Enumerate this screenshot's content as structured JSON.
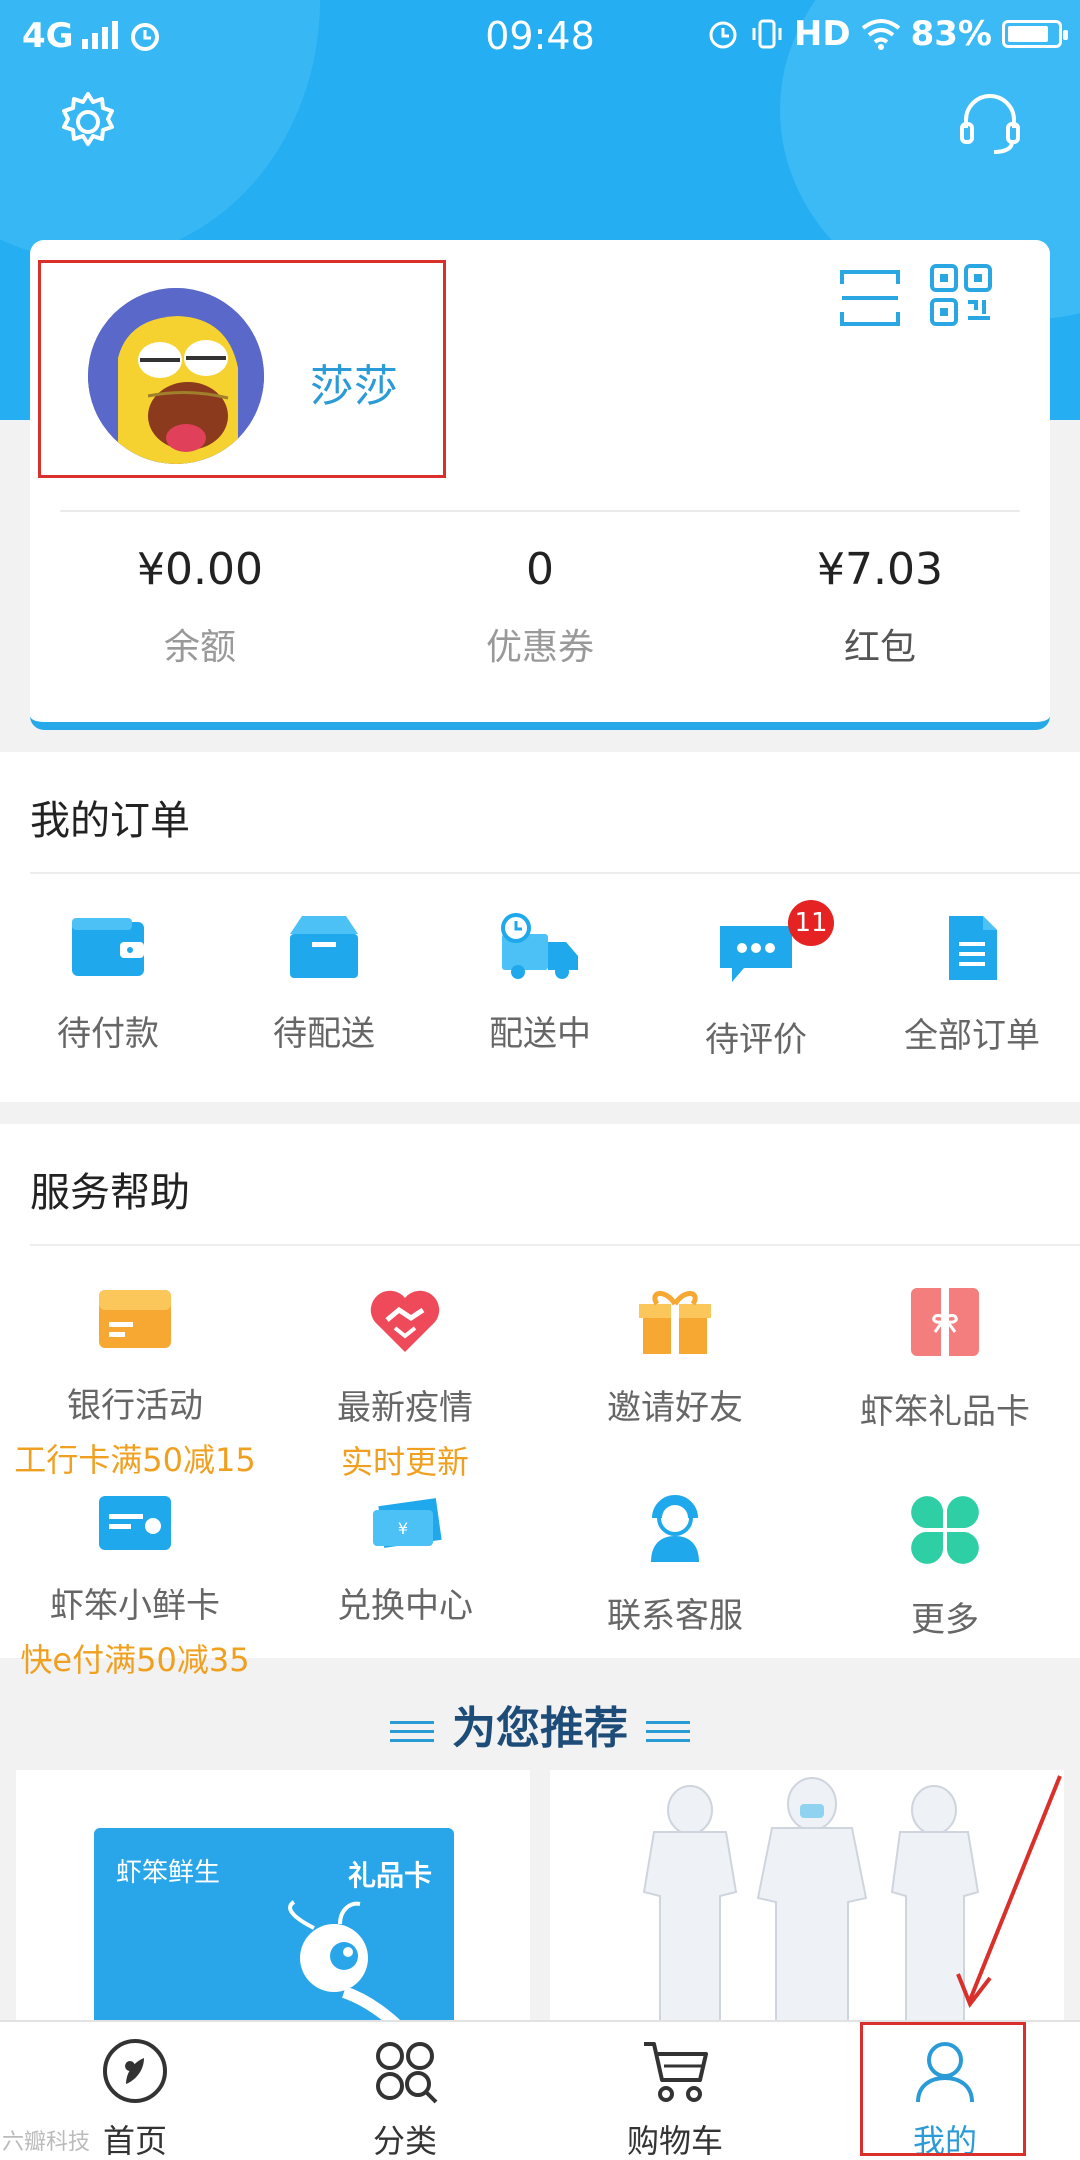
{
  "status_bar": {
    "network": "4G",
    "time": "09:48",
    "hd": "HD",
    "battery": "83%",
    "battery_level": 0.83
  },
  "profile": {
    "username": "莎莎"
  },
  "stats": [
    {
      "value": "¥0.00",
      "label": "余额"
    },
    {
      "value": "0",
      "label": "优惠券"
    },
    {
      "value": "¥7.03",
      "label": "红包"
    }
  ],
  "orders": {
    "title": "我的订单",
    "items": [
      {
        "label": "待付款",
        "icon": "wallet-icon"
      },
      {
        "label": "待配送",
        "icon": "box-icon"
      },
      {
        "label": "配送中",
        "icon": "truck-icon"
      },
      {
        "label": "待评价",
        "icon": "chat-icon",
        "badge": "11"
      },
      {
        "label": "全部订单",
        "icon": "document-icon"
      }
    ]
  },
  "services": {
    "title": "服务帮助",
    "items": [
      {
        "label": "银行活动",
        "sub": "工行卡满50减15",
        "icon": "bank-card-icon"
      },
      {
        "label": "最新疫情",
        "sub": "实时更新",
        "icon": "heart-handshake-icon"
      },
      {
        "label": "邀请好友",
        "sub": "",
        "icon": "gift-icon"
      },
      {
        "label": "虾笨礼品卡",
        "sub": "",
        "icon": "gift-card-icon"
      },
      {
        "label": "虾笨小鲜卡",
        "sub": "快e付满50减35",
        "icon": "fresh-card-icon"
      },
      {
        "label": "兑换中心",
        "sub": "",
        "icon": "ticket-icon"
      },
      {
        "label": "联系客服",
        "sub": "",
        "icon": "customer-service-icon"
      },
      {
        "label": "更多",
        "sub": "",
        "icon": "more-icon"
      }
    ]
  },
  "recommend": {
    "title": "为您推荐"
  },
  "products": [
    {
      "brand": "虾笨鲜生",
      "label": "礼品卡"
    },
    {
      "image": "protective-suits-photo"
    }
  ],
  "nav": [
    {
      "label": "首页",
      "icon": "home-icon"
    },
    {
      "label": "分类",
      "icon": "category-icon"
    },
    {
      "label": "购物车",
      "icon": "cart-icon"
    },
    {
      "label": "我的",
      "icon": "user-icon",
      "active": true
    }
  ],
  "watermark": "六瓣科技",
  "colors": {
    "primary": "#26aef2",
    "accent_text": "#2a9bd6",
    "promo": "#f0a020",
    "highlight": "#d9302b",
    "badge": "#e52323"
  }
}
